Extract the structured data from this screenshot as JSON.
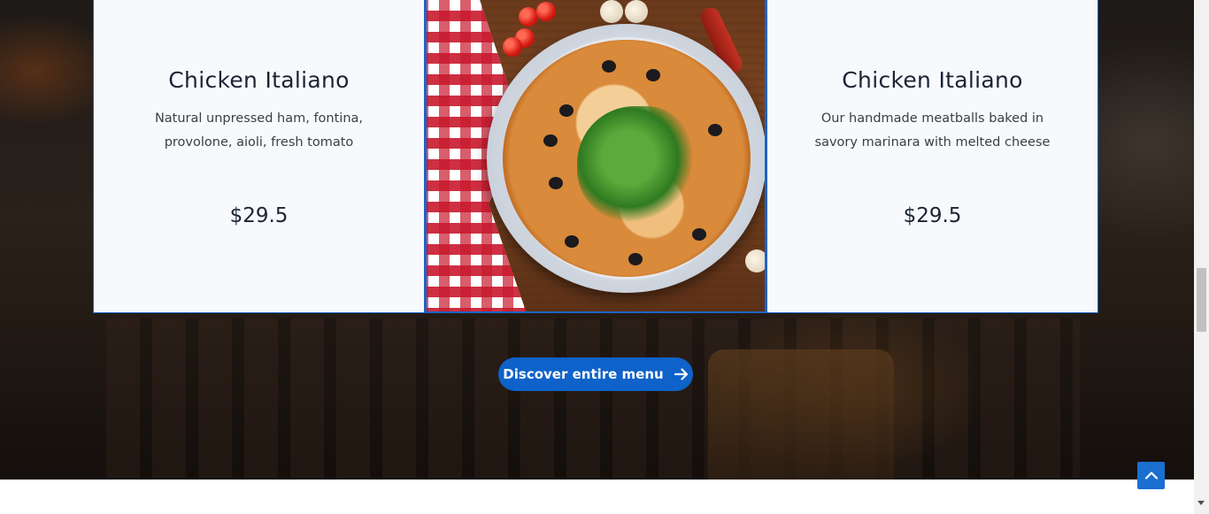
{
  "menu_cards": [
    {
      "title": "Chicken Italiano",
      "description": "Natural unpressed ham, fontina, provolone, aioli, fresh tomato",
      "price": "$29.5"
    },
    {
      "image": "pizza-photo"
    },
    {
      "title": "Chicken Italiano",
      "description": "Our handmade meatballs baked in savory marinara with melted cheese",
      "price": "$29.5"
    }
  ],
  "discover_button": {
    "label": "Discover entire menu",
    "icon": "arrow-right-icon"
  },
  "scroll_to_top": {
    "icon": "chevron-up-icon"
  },
  "colors": {
    "accent": "#0e62c9",
    "card_border": "#1e63c4",
    "card_background": "#f7f9fc",
    "heading_text": "#1c2433"
  }
}
